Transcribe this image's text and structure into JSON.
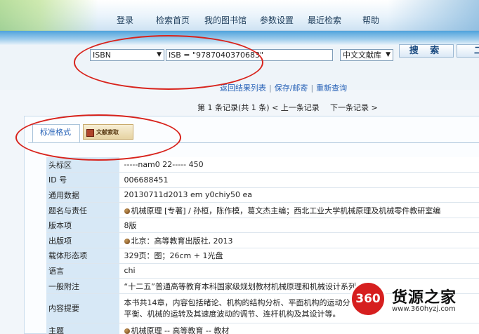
{
  "nav": [
    "登录",
    "检索首页",
    "我的图书馆",
    "参数设置",
    "最近检索",
    "帮助"
  ],
  "search": {
    "field_select": "ISBN",
    "query": "ISB = \"9787040370683\"",
    "library_select": "中文文献库",
    "search_button": "搜 索",
    "edge_button": "二"
  },
  "links": [
    "返回结果列表",
    "保存/邮寄",
    "重新查询"
  ],
  "recnav": {
    "status": "第 1 条记录(共 1 条)",
    "prev": "< 上一条记录",
    "next": "下一条记录 >"
  },
  "tabs": {
    "standard": "标准格式",
    "document": "文献索取"
  },
  "record": [
    {
      "key": "头标区",
      "value": "-----nam0 22----- 450"
    },
    {
      "key": "ID 号",
      "value": "006688451"
    },
    {
      "key": "通用数据",
      "value": "20130711d2013 em y0chiy50 ea"
    },
    {
      "key": "题名与责任",
      "value": "机械原理 [专著] / 孙桓，陈作模，葛文杰主编；西北工业大学机械原理及机械零件教研室编",
      "bullet": true
    },
    {
      "key": "版本项",
      "value": "8版"
    },
    {
      "key": "出版项",
      "value": "北京：高等教育出版社, 2013",
      "bullet": true
    },
    {
      "key": "载体形态项",
      "value": "329页：图；26cm + 1光盘"
    },
    {
      "key": "语言",
      "value": "chi"
    },
    {
      "key": "一般附注",
      "value": "“十二五”普通高等教育本科国家级规划教材机械原理和机械设计系列"
    },
    {
      "key": "内容提要",
      "value": "本书共14章，内容包括绪论、机构的结构分析、平面机构的运动分析",
      "value2": "平衡、机械的运转及其速度波动的调节、连杆机构及其设计等。",
      "multi": true
    },
    {
      "key": "主题",
      "value": "机械原理 -- 高等教育 -- 教材",
      "bullet": true
    }
  ],
  "watermark": {
    "logo": "360",
    "name": "货源之家",
    "url": "www.360hyzj.com"
  },
  "colors": {
    "annotation_red": "#d8231c",
    "label_bg": "#d7e8f6",
    "link_blue": "#2a64b8"
  }
}
